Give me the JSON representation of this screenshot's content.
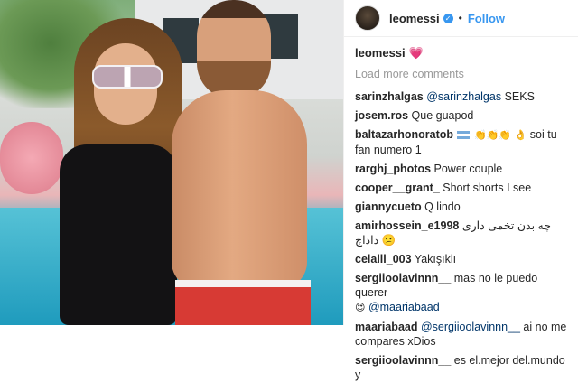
{
  "post": {
    "photo": {
      "alt": ""
    },
    "header": {
      "username": "leomessi",
      "verified_icon": "verified-badge-icon",
      "separator": "•",
      "follow_label": "Follow"
    },
    "caption": {
      "username": "leomessi",
      "emoji": "💗"
    },
    "load_more": "Load more comments",
    "comments": [
      {
        "user": "sarinzhalgas",
        "mention": "@sarinzhalgas",
        "text": " SEKS"
      },
      {
        "user": "josem.ros",
        "text": " Que guapod"
      },
      {
        "user": "baltazarhonoratob",
        "text": " soi tu fan numero 1",
        "icons": "argentina-flag-icon clapping-hands-icon ok-hand-icon"
      },
      {
        "user": "rarghj_photos",
        "text": " Power couple"
      },
      {
        "user": "cooper__grant_",
        "text": " Short shorts I see"
      },
      {
        "user": "giannycueto",
        "text": " Q lindo"
      },
      {
        "user": "amirhossein_e1998",
        "text": " چه بدن تخمی داری داداچ 😕"
      },
      {
        "user": "celalll_003",
        "text": " Yakışıklı"
      },
      {
        "user": "sergiioolavinnn__",
        "text": " mas no le puedo querer",
        "line2_emoji": "😍",
        "line2_mention": "@maariabaad"
      },
      {
        "user": "maariabaad",
        "mention": "@sergiioolavinnn__",
        "text": " ai no me compares xDios"
      },
      {
        "user": "sergiioolavinnn__",
        "text": " es el.mejor del.mundo y"
      }
    ]
  }
}
